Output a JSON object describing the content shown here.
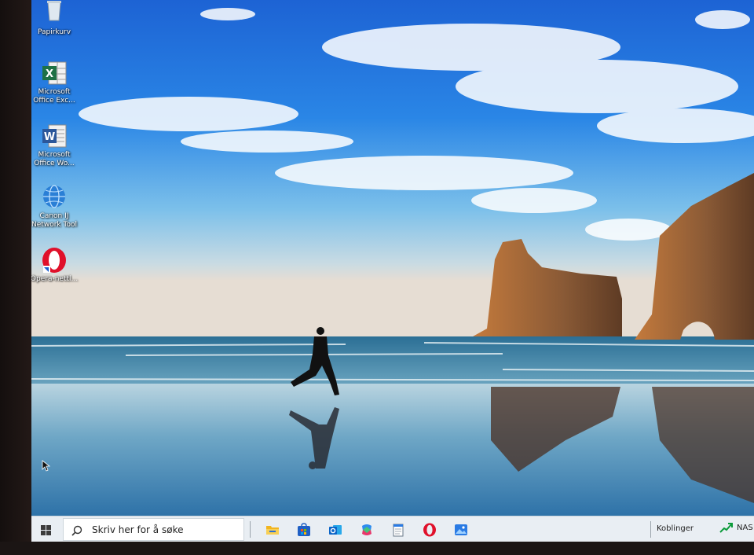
{
  "desktop": {
    "icons": [
      {
        "name": "recycle-bin",
        "label": "Papirkurv"
      },
      {
        "name": "excel",
        "label": "Microsoft Office Exc..."
      },
      {
        "name": "word",
        "label": "Microsoft Office Wo..."
      },
      {
        "name": "canon",
        "label": "Canon IJ Network Tool"
      },
      {
        "name": "opera",
        "label": "Opera-nettl..."
      }
    ]
  },
  "taskbar": {
    "search_placeholder": "Skriv her for å søke",
    "pinned": [
      "file-explorer-icon",
      "microsoft-store-icon",
      "outlook-icon",
      "copilot-icon",
      "notepad-icon",
      "opera-icon",
      "photos-icon"
    ],
    "links_label": "Koblinger",
    "stock_label": "NAS"
  },
  "colors": {
    "taskbar_bg": "#e9eef3",
    "sky_top": "#1e6fd9",
    "opera_red": "#e0102a",
    "excel_green": "#1e7145",
    "word_blue": "#2b579a"
  }
}
